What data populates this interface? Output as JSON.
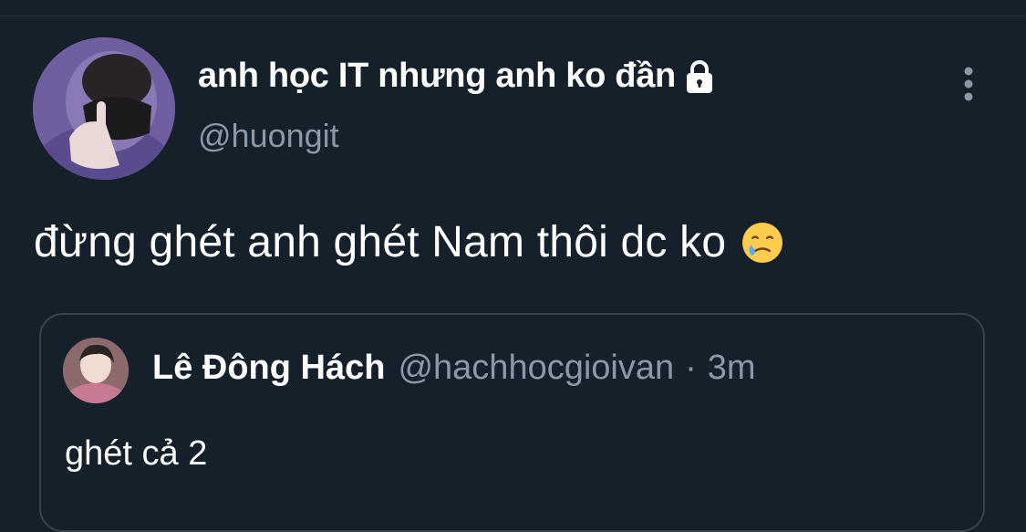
{
  "author": {
    "display_name": "anh học IT nhưng anh ko đần",
    "handle": "@huongit",
    "protected_icon": "lock-icon"
  },
  "tweet": {
    "text": "đừng ghét anh ghét Nam thôi dc ko",
    "emoji": "face-holding-back-tears"
  },
  "quoted_tweet": {
    "display_name": "Lê Đông Hách",
    "handle": "@hachhocgioivan",
    "separator": "·",
    "time": "3m",
    "text": "ghét cả 2"
  },
  "icons": {
    "more": "more-vertical-icon"
  },
  "colors": {
    "background": "#15202b",
    "secondary_text": "#8b98a5",
    "border": "#38444d"
  }
}
